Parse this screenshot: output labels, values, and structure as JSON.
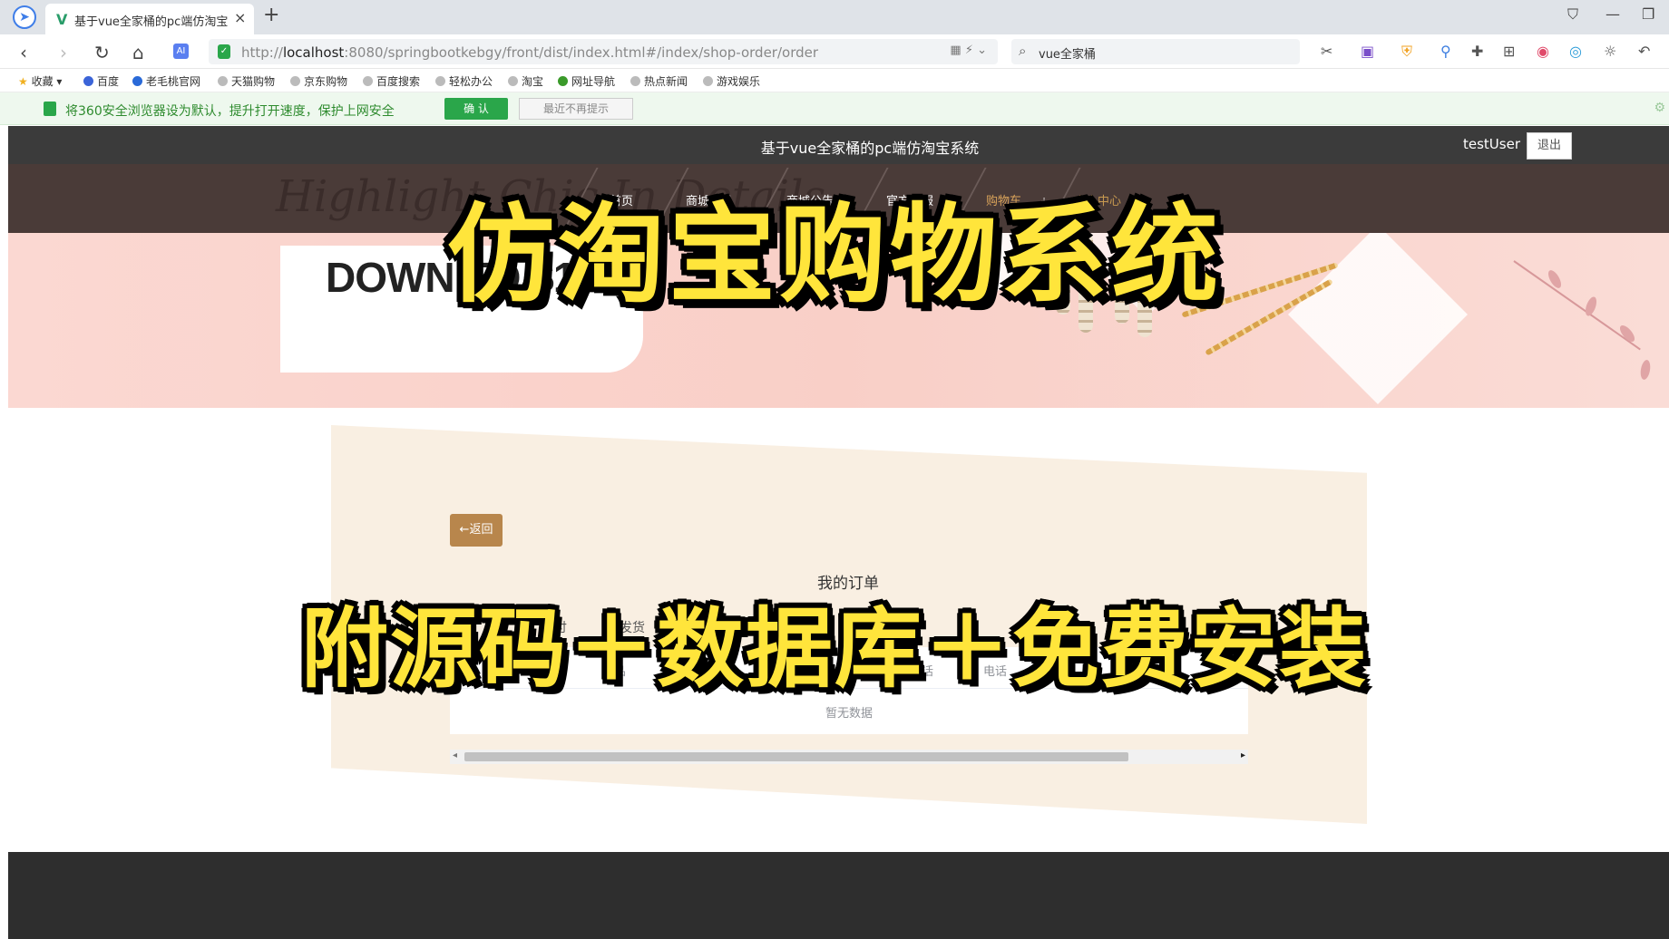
{
  "browser": {
    "tab_title": "基于vue全家桶的pc端仿淘宝系",
    "url_prefix": "http://",
    "url_host": "localhost",
    "url_rest": ":8080/springbootkebgy/front/dist/index.html#/index/shop-order/order",
    "search_value": "vue全家桶",
    "ai_badge": "AI",
    "favorites": [
      "收藏",
      "百度",
      "老毛桃官网",
      "天猫购物",
      "京东购物",
      "百度搜索",
      "轻松办公",
      "淘宝",
      "网址导航",
      "热点新闻",
      "游戏娱乐"
    ],
    "infobar_text": "将360安全浏览器设为默认，提升打开速度，保护上网安全",
    "infobar_confirm": "确 认",
    "infobar_later": "最近不再提示"
  },
  "site": {
    "title": "基于vue全家桶的pc端仿淘宝系统",
    "username": "testUser",
    "logout_label": "退出",
    "nav_bg_text": "Highlight Chic In Details",
    "nav": [
      "首页",
      "商城商品",
      "商城公告",
      "官方客服",
      "购物车",
      "个人中心"
    ]
  },
  "banner": {
    "promo_text": "DOWN TO $1.29"
  },
  "overlay": {
    "title": "仿淘宝购物系统",
    "subtitle": "附源码＋数据库＋免费安装"
  },
  "orders": {
    "back_label": "←返回",
    "title": "我的订单",
    "status_tabs": [
      "付",
      "已发货"
    ],
    "columns": [
      "商品",
      "话",
      "电话"
    ],
    "empty_text": "暂无数据"
  },
  "colors": {
    "accent_gold": "#b8864c",
    "nav_active": "#d9a35a",
    "overlay_yellow": "#ffe53b",
    "infobar_green": "#2aa64a"
  }
}
